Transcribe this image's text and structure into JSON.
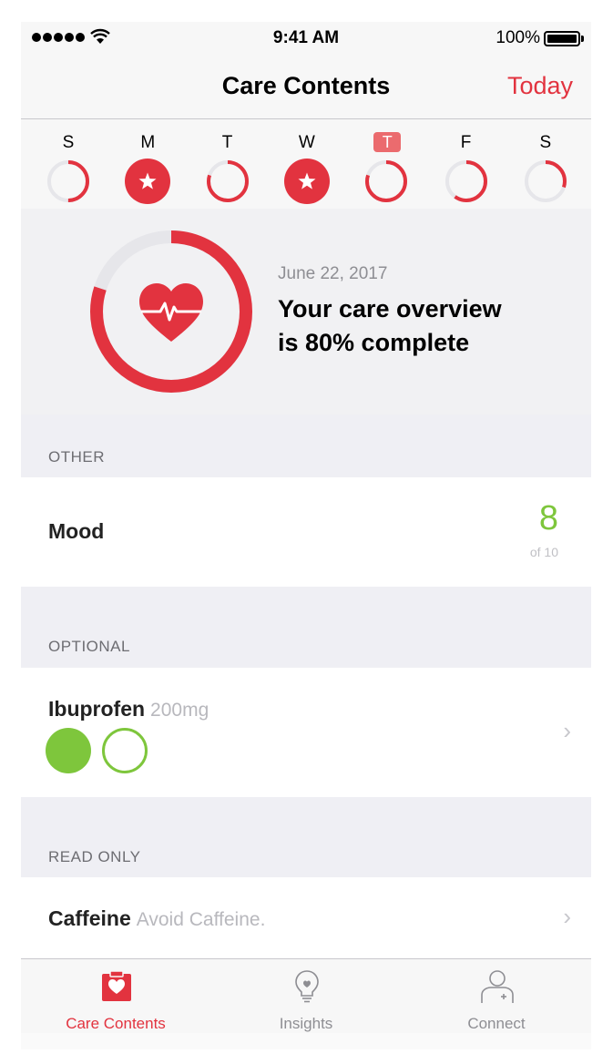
{
  "status_bar": {
    "time": "9:41 AM",
    "battery": "100%"
  },
  "nav": {
    "title": "Care Contents",
    "right_action": "Today"
  },
  "week": {
    "days": [
      {
        "letter": "S",
        "progress": 0.5,
        "completed": false,
        "is_today": false
      },
      {
        "letter": "M",
        "progress": 1.0,
        "completed": true,
        "is_today": false
      },
      {
        "letter": "T",
        "progress": 0.8,
        "completed": false,
        "is_today": false
      },
      {
        "letter": "W",
        "progress": 1.0,
        "completed": true,
        "is_today": false
      },
      {
        "letter": "T",
        "progress": 0.8,
        "completed": false,
        "is_today": true
      },
      {
        "letter": "F",
        "progress": 0.6,
        "completed": false,
        "is_today": false
      },
      {
        "letter": "S",
        "progress": 0.3,
        "completed": false,
        "is_today": false
      }
    ]
  },
  "overview": {
    "date": "June 22, 2017",
    "headline_line1": "Your care overview",
    "headline_line2": "is 80% complete",
    "progress": 0.8
  },
  "sections": {
    "other": {
      "header": "OTHER",
      "item_name": "Mood",
      "value": "8",
      "value_of": "of 10"
    },
    "optional": {
      "header": "OPTIONAL",
      "item_name": "Ibuprofen",
      "item_detail": "200mg",
      "doses_taken": 1,
      "doses_total": 2
    },
    "read_only": {
      "header": "READ ONLY",
      "item_name": "Caffeine",
      "item_detail": "Avoid Caffeine."
    }
  },
  "tabs": [
    {
      "label": "Care Contents",
      "icon": "care-card-icon",
      "active": true
    },
    {
      "label": "Insights",
      "icon": "lightbulb-icon",
      "active": false
    },
    {
      "label": "Connect",
      "icon": "person-add-icon",
      "active": false
    }
  ],
  "colors": {
    "accent_red": "#e2333f",
    "green": "#7ec63c",
    "track": "#e6e6ea"
  }
}
